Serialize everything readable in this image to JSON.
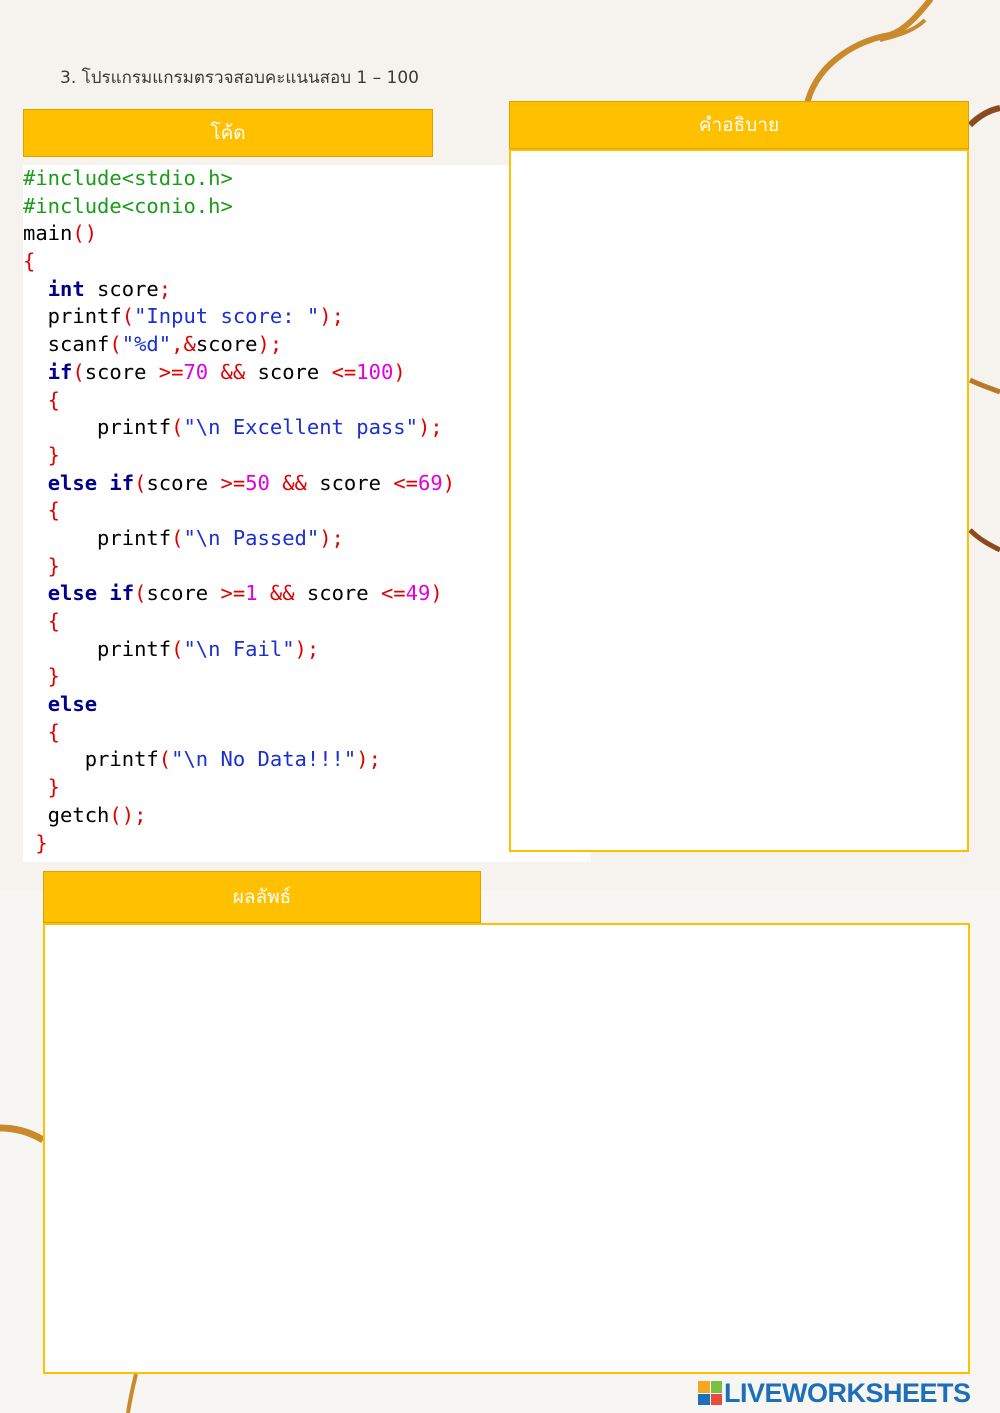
{
  "title": "3. โปรแกรมแกรมตรวจสอบคะแนนสอบ 1 – 100",
  "headers": {
    "code": "โค้ด",
    "description": "คำอธิบาย",
    "result": "ผลลัพธ์"
  },
  "code_lines": [
    [
      {
        "t": "#include<stdio.h>",
        "c": "pp"
      }
    ],
    [
      {
        "t": "#include<conio.h>",
        "c": "pp"
      }
    ],
    [
      {
        "t": "main",
        "c": "fn"
      },
      {
        "t": "()",
        "c": "pn"
      }
    ],
    [
      {
        "t": "{",
        "c": "pn"
      }
    ],
    [
      {
        "t": "  ",
        "c": "fn"
      },
      {
        "t": "int",
        "c": "kw"
      },
      {
        "t": " score",
        "c": "fn"
      },
      {
        "t": ";",
        "c": "pn"
      }
    ],
    [
      {
        "t": "  printf",
        "c": "fn"
      },
      {
        "t": "(",
        "c": "pn"
      },
      {
        "t": "\"Input score: \"",
        "c": "str"
      },
      {
        "t": ");",
        "c": "pn"
      }
    ],
    [
      {
        "t": "  scanf",
        "c": "fn"
      },
      {
        "t": "(",
        "c": "pn"
      },
      {
        "t": "\"%d\"",
        "c": "str"
      },
      {
        "t": ",&",
        "c": "pn"
      },
      {
        "t": "score",
        "c": "fn"
      },
      {
        "t": ");",
        "c": "pn"
      }
    ],
    [
      {
        "t": "  ",
        "c": "fn"
      },
      {
        "t": "if",
        "c": "kw"
      },
      {
        "t": "(",
        "c": "pn"
      },
      {
        "t": "score ",
        "c": "fn"
      },
      {
        "t": ">=",
        "c": "op"
      },
      {
        "t": "70",
        "c": "num"
      },
      {
        "t": " && ",
        "c": "op"
      },
      {
        "t": "score ",
        "c": "fn"
      },
      {
        "t": "<=",
        "c": "op"
      },
      {
        "t": "100",
        "c": "num"
      },
      {
        "t": ")",
        "c": "pn"
      }
    ],
    [
      {
        "t": "  {",
        "c": "pn"
      }
    ],
    [
      {
        "t": "      printf",
        "c": "fn"
      },
      {
        "t": "(",
        "c": "pn"
      },
      {
        "t": "\"\\n Excellent pass\"",
        "c": "str"
      },
      {
        "t": ");",
        "c": "pn"
      }
    ],
    [
      {
        "t": "  }",
        "c": "pn"
      }
    ],
    [
      {
        "t": "  ",
        "c": "fn"
      },
      {
        "t": "else if",
        "c": "kw"
      },
      {
        "t": "(",
        "c": "pn"
      },
      {
        "t": "score ",
        "c": "fn"
      },
      {
        "t": ">=",
        "c": "op"
      },
      {
        "t": "50",
        "c": "num"
      },
      {
        "t": " && ",
        "c": "op"
      },
      {
        "t": "score ",
        "c": "fn"
      },
      {
        "t": "<=",
        "c": "op"
      },
      {
        "t": "69",
        "c": "num"
      },
      {
        "t": ")",
        "c": "pn"
      }
    ],
    [
      {
        "t": "  {",
        "c": "pn"
      }
    ],
    [
      {
        "t": "      printf",
        "c": "fn"
      },
      {
        "t": "(",
        "c": "pn"
      },
      {
        "t": "\"\\n Passed\"",
        "c": "str"
      },
      {
        "t": ");",
        "c": "pn"
      }
    ],
    [
      {
        "t": "  }",
        "c": "pn"
      }
    ],
    [
      {
        "t": "  ",
        "c": "fn"
      },
      {
        "t": "else if",
        "c": "kw"
      },
      {
        "t": "(",
        "c": "pn"
      },
      {
        "t": "score ",
        "c": "fn"
      },
      {
        "t": ">=",
        "c": "op"
      },
      {
        "t": "1",
        "c": "num"
      },
      {
        "t": " && ",
        "c": "op"
      },
      {
        "t": "score ",
        "c": "fn"
      },
      {
        "t": "<=",
        "c": "op"
      },
      {
        "t": "49",
        "c": "num"
      },
      {
        "t": ")",
        "c": "pn"
      }
    ],
    [
      {
        "t": "  {",
        "c": "pn"
      }
    ],
    [
      {
        "t": "      printf",
        "c": "fn"
      },
      {
        "t": "(",
        "c": "pn"
      },
      {
        "t": "\"\\n Fail\"",
        "c": "str"
      },
      {
        "t": ");",
        "c": "pn"
      }
    ],
    [
      {
        "t": "  }",
        "c": "pn"
      }
    ],
    [
      {
        "t": "  ",
        "c": "fn"
      },
      {
        "t": "else",
        "c": "kw"
      }
    ],
    [
      {
        "t": "  {",
        "c": "pn"
      }
    ],
    [
      {
        "t": "     printf",
        "c": "fn"
      },
      {
        "t": "(",
        "c": "pn"
      },
      {
        "t": "\"\\n No Data!!!\"",
        "c": "str"
      },
      {
        "t": ");",
        "c": "pn"
      }
    ],
    [
      {
        "t": "  }",
        "c": "pn"
      }
    ],
    [
      {
        "t": "  getch",
        "c": "fn"
      },
      {
        "t": "();",
        "c": "pn"
      }
    ],
    [
      {
        "t": " }",
        "c": "pn"
      }
    ]
  ],
  "description_text": "",
  "result_text": "",
  "brand": "LIVEWORKSHEETS",
  "colors": {
    "header_fill": "#ffc000",
    "header_text": "#ffffff",
    "box_border": "#ffc000",
    "brand_blue": "#1d6fb8",
    "decoration": "#c98a2c"
  }
}
